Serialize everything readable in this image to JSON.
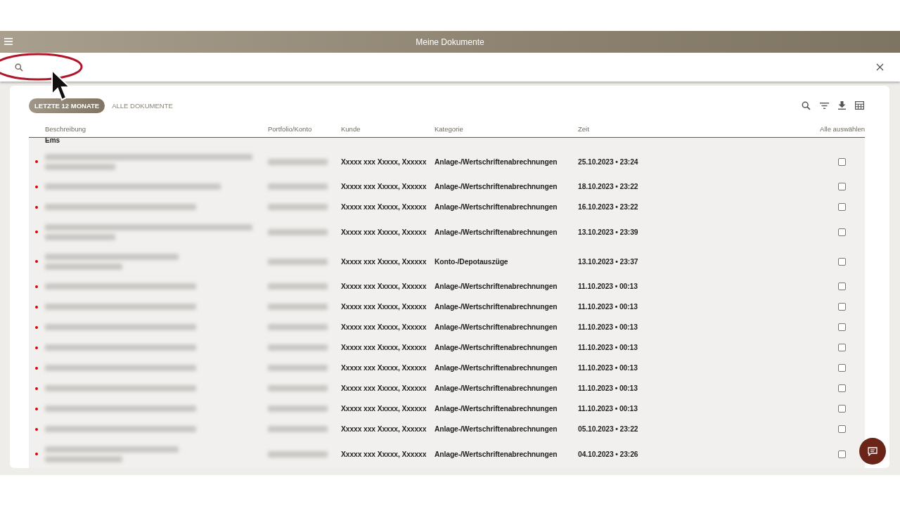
{
  "header": {
    "title": "Meine Dokumente"
  },
  "tabs": [
    {
      "label": "LETZTE 12 MONATE",
      "selected": true
    },
    {
      "label": "ALLE DOKUMENTE",
      "selected": false
    }
  ],
  "table": {
    "columns": [
      "Beschreibung",
      "Portfolio/Konto",
      "Kunde",
      "Kategorie",
      "Zeit"
    ],
    "select_all": "Alle auswählen",
    "group_label": "Ems",
    "rows": [
      {
        "kind": "two-line",
        "unread": true,
        "customer": "Xxxxx xxx Xxxxx, Xxxxxx",
        "category": "Anlage-/Wertschriftenabrechnungen",
        "time": "25.10.2023 • 23:24",
        "checked": false
      },
      {
        "kind": "one-line",
        "unread": true,
        "customer": "Xxxxx xxx Xxxxx, Xxxxxx",
        "category": "Anlage-/Wertschriftenabrechnungen",
        "time": "18.10.2023 • 23:22",
        "checked": false
      },
      {
        "kind": "one-line",
        "unread": true,
        "customer": "Xxxxx xxx Xxxxx, Xxxxxx",
        "category": "Anlage-/Wertschriftenabrechnungen",
        "time": "16.10.2023 • 23:22",
        "checked": false
      },
      {
        "kind": "two-line",
        "unread": true,
        "customer": "Xxxxx xxx Xxxxx, Xxxxxx",
        "category": "Anlage-/Wertschriftenabrechnungen",
        "time": "13.10.2023 • 23:39",
        "checked": false
      },
      {
        "kind": "two-line",
        "unread": true,
        "customer": "Xxxxx xxx Xxxxx, Xxxxxx",
        "category": "Konto-/Depotauszüge",
        "time": "13.10.2023 • 23:37",
        "checked": false
      },
      {
        "kind": "one-line",
        "unread": true,
        "customer": "Xxxxx xxx Xxxxx, Xxxxxx",
        "category": "Anlage-/Wertschriftenabrechnungen",
        "time": "11.10.2023 • 00:13",
        "checked": false
      },
      {
        "kind": "one-line",
        "unread": true,
        "customer": "Xxxxx xxx Xxxxx, Xxxxxx",
        "category": "Anlage-/Wertschriftenabrechnungen",
        "time": "11.10.2023 • 00:13",
        "checked": false
      },
      {
        "kind": "one-line",
        "unread": true,
        "customer": "Xxxxx xxx Xxxxx, Xxxxxx",
        "category": "Anlage-/Wertschriftenabrechnungen",
        "time": "11.10.2023 • 00:13",
        "checked": false
      },
      {
        "kind": "one-line",
        "unread": true,
        "customer": "Xxxxx xxx Xxxxx, Xxxxxx",
        "category": "Anlage-/Wertschriftenabrechnungen",
        "time": "11.10.2023 • 00:13",
        "checked": false
      },
      {
        "kind": "one-line",
        "unread": true,
        "customer": "Xxxxx xxx Xxxxx, Xxxxxx",
        "category": "Anlage-/Wertschriftenabrechnungen",
        "time": "11.10.2023 • 00:13",
        "checked": false
      },
      {
        "kind": "one-line",
        "unread": true,
        "customer": "Xxxxx xxx Xxxxx, Xxxxxx",
        "category": "Anlage-/Wertschriftenabrechnungen",
        "time": "11.10.2023 • 00:13",
        "checked": false
      },
      {
        "kind": "one-line",
        "unread": true,
        "customer": "Xxxxx xxx Xxxxx, Xxxxxx",
        "category": "Anlage-/Wertschriftenabrechnungen",
        "time": "11.10.2023 • 00:13",
        "checked": false
      },
      {
        "kind": "one-line",
        "unread": true,
        "customer": "Xxxxx xxx Xxxxx, Xxxxxx",
        "category": "Anlage-/Wertschriftenabrechnungen",
        "time": "05.10.2023 • 23:22",
        "checked": false
      },
      {
        "kind": "two-line",
        "unread": true,
        "customer": "Xxxxx xxx Xxxxx, Xxxxxx",
        "category": "Anlage-/Wertschriftenabrechnungen",
        "time": "04.10.2023 • 23:26",
        "checked": false
      }
    ]
  }
}
